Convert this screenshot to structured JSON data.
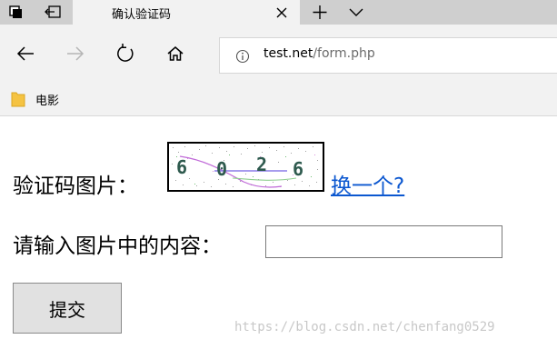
{
  "tab": {
    "title": "确认验证码"
  },
  "address": {
    "host": "test.net",
    "path": "/form.php"
  },
  "favorites": {
    "items": [
      {
        "label": "电影"
      }
    ]
  },
  "form": {
    "captcha_label": "验证码图片：",
    "captcha_digits": [
      "6",
      "0",
      "2",
      "6"
    ],
    "change_link": "换一个?",
    "input_label": "请输入图片中的内容：",
    "input_value": "",
    "submit_label": "提交"
  },
  "watermark": "https://blog.csdn.net/chenfang0529",
  "colors": {
    "link": "#0b57d0",
    "chrome": "#f2f2f2",
    "tabstrip": "#cfcfcf"
  }
}
